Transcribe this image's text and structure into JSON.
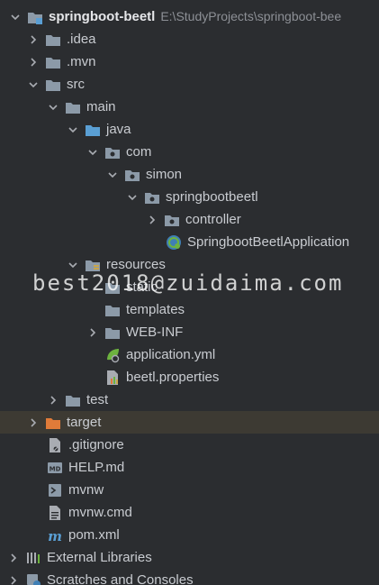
{
  "project": {
    "name": "springboot-beetl",
    "path": "E:\\StudyProjects\\springboot-bee"
  },
  "nodes": {
    "idea": ".idea",
    "mvn": ".mvn",
    "src": "src",
    "main": "main",
    "java": "java",
    "com": "com",
    "simon": "simon",
    "springbootbeetl": "springbootbeetl",
    "controller": "controller",
    "app_class": "SpringbootBeetlApplication",
    "resources": "resources",
    "static": "static",
    "templates": "templates",
    "webinf": "WEB-INF",
    "application_yml": "application.yml",
    "beetl_properties": "beetl.properties",
    "test": "test",
    "target": "target",
    "gitignore": ".gitignore",
    "help_md": "HELP.md",
    "mvnw": "mvnw",
    "mvnw_cmd": "mvnw.cmd",
    "pom_xml": "pom.xml",
    "external_libraries": "External Libraries",
    "scratches": "Scratches and Consoles"
  },
  "watermark": "best2018@zuidaima.com",
  "colors": {
    "background": "#2b2d30",
    "folder": "#8c9aa8",
    "source_folder": "#5a9fd4",
    "resource_folder": "#8c9aa8",
    "target_folder": "#e07b39",
    "spring_green": "#6db33f",
    "text": "#c9ccd1",
    "path": "#8d9096"
  }
}
